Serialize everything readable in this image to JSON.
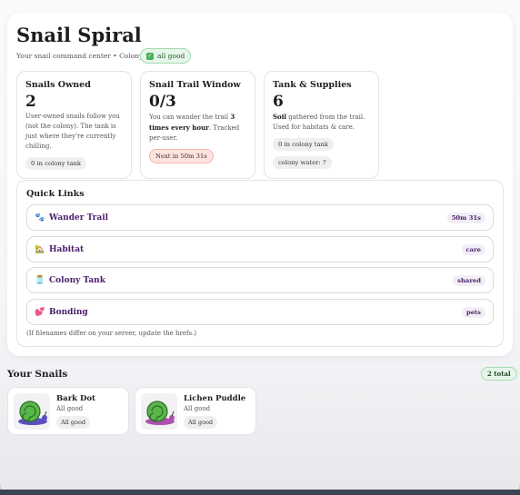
{
  "header": {
    "title": "Snail Spiral",
    "subtitle": "Your snail command center • Colony #6",
    "status_badge": "all good"
  },
  "stats": [
    {
      "title": "Snails Owned",
      "value": "2",
      "desc": "User-owned snails follow you (not the colony). The tank is just where they're currently chilling.",
      "pill": "0 in colony tank"
    },
    {
      "title": "Snail Trail Window",
      "value": "0/3",
      "desc_pre": "You can wander the trail ",
      "desc_bold": "3 times every hour",
      "desc_post": ". Tracked per-user.",
      "pill": "Next in 50m 31s"
    },
    {
      "title": "Tank & Supplies",
      "value": "6",
      "desc_bold": "Soil",
      "desc_post": " gathered from the trail. Used for habitats & care.",
      "pill1": "0 in colony tank",
      "pill2": "colony water: ?"
    }
  ],
  "quick_links": {
    "title": "Quick Links",
    "items": [
      {
        "label": "Wander Trail",
        "tag": "50m 31s",
        "icon": "paw-icon"
      },
      {
        "label": "Habitat",
        "tag": "care",
        "icon": "house-icon"
      },
      {
        "label": "Colony Tank",
        "tag": "shared",
        "icon": "jar-icon"
      },
      {
        "label": "Bonding",
        "tag": "pets",
        "icon": "hearts-icon"
      }
    ],
    "note": "(If filenames differ on your server, update the hrefs.)"
  },
  "snails": {
    "title": "Your Snails",
    "total": "2 total",
    "items": [
      {
        "name": "Bark Dot",
        "status": "All good",
        "pill": "All good",
        "body_color": "#5a4fc0"
      },
      {
        "name": "Lichen Puddle",
        "status": "All good",
        "pill": "All good",
        "body_color": "#b04fb0"
      }
    ]
  },
  "colors": {
    "accent": "#4a1c6b",
    "good": "#4bb05a",
    "warn_bg": "#fde3df"
  }
}
